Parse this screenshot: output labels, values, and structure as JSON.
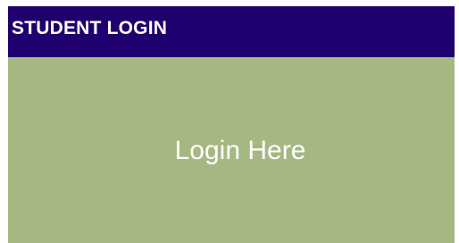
{
  "header": {
    "title": "STUDENT LOGIN"
  },
  "body": {
    "login_label": "Login Here"
  },
  "colors": {
    "header_bg": "#1f006e",
    "body_bg": "#a6b882",
    "text": "#ffffff"
  }
}
